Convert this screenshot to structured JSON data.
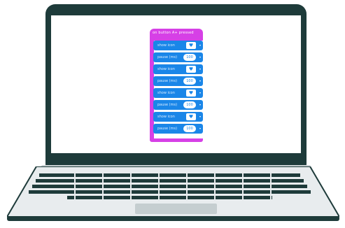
{
  "blocks": {
    "hat_label": "on button A+ pressed",
    "items": [
      {
        "label": "show icon",
        "icon": "heart-icon",
        "glyph": "♥"
      },
      {
        "label": "pause (ms)",
        "value": "100"
      },
      {
        "label": "show icon",
        "icon": "heart-icon",
        "glyph": "♥"
      },
      {
        "label": "pause (ms)",
        "value": "100"
      },
      {
        "label": "show icon",
        "icon": "heart-icon",
        "glyph": "♥"
      },
      {
        "label": "pause (ms)",
        "value": "100"
      },
      {
        "label": "show icon",
        "icon": "heart-icon",
        "glyph": "♥"
      },
      {
        "label": "pause (ms)",
        "value": "100"
      }
    ]
  },
  "colors": {
    "event_block": "#d640e6",
    "basic_block": "#1a86e8",
    "laptop_frame": "#1e3b3a"
  }
}
